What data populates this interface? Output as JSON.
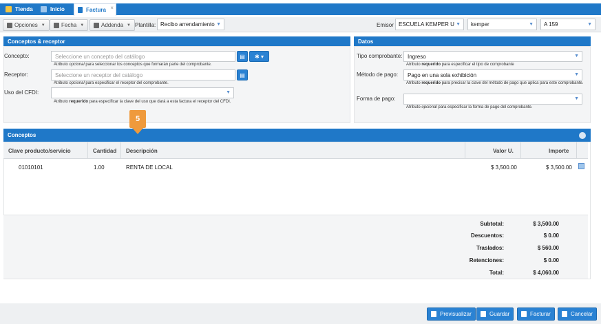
{
  "tabs": [
    {
      "label": "Tienda",
      "icon": "store-icon"
    },
    {
      "label": "Inicio",
      "icon": "home-icon"
    },
    {
      "label": "Factura",
      "icon": "document-icon",
      "close": "×"
    }
  ],
  "toolbar": {
    "opciones": "Opciones",
    "fecha": "Fecha",
    "addenda": "Addenda",
    "plantilla_label": "Plantilla:",
    "plantilla_value": "Recibo arrendamiento",
    "emisor_label": "Emisor",
    "emisor_value": "ESCUELA KEMPER U",
    "kemper_value": "kemper",
    "serie_value": "A 159"
  },
  "conceptos_receptor": {
    "title": "Conceptos & receptor",
    "concepto_label": "Concepto:",
    "concepto_placeholder": "Seleccione un concepto del catálogo",
    "concepto_hint_pre": "Atributo ",
    "concepto_hint_em": "opcional",
    "concepto_hint_post": " para seleccionar los conceptos que formarán parte del comprobante.",
    "receptor_label": "Receptor:",
    "receptor_placeholder": "Seleccione un receptor del catálogo",
    "receptor_hint_pre": "Atributo ",
    "receptor_hint_em": "opcional",
    "receptor_hint_post": " para especificar el receptor del comprobante.",
    "uso_label": "Uso del CFDI:",
    "uso_hint_pre": "Atributo ",
    "uso_hint_em": "requerido",
    "uso_hint_post": " para especificar la clave del uso que dará a esta factura el receptor del CFDI."
  },
  "datos": {
    "title": "Datos",
    "tipo_label": "Tipo comprobante:",
    "tipo_value": "Ingreso",
    "tipo_hint_pre": "Atributo ",
    "tipo_hint_em": "requerido",
    "tipo_hint_post": " para especificar el tipo de comprobante",
    "metodo_label": "Método de pago:",
    "metodo_value": "Pago en una sola exhibición",
    "metodo_hint_pre": "Atributo ",
    "metodo_hint_em": "requerido",
    "metodo_hint_post": " para precisar la clave del método de pago que aplica para este comprobante.",
    "forma_label": "Forma de pago:",
    "forma_hint_pre": "Atributo ",
    "forma_hint_em": "opcional",
    "forma_hint_post": " para especificar la forma de pago del comprobante."
  },
  "conceptos": {
    "title": "Conceptos",
    "columns": [
      "Clave producto/servicio",
      "Cantidad",
      "Descripción",
      "Valor U.",
      "Importe"
    ],
    "rows": [
      {
        "clave": "01010101",
        "cantidad": "1.00",
        "descripcion": "RENTA DE LOCAL",
        "valor": "$ 3,500.00",
        "importe": "$ 3,500.00"
      }
    ],
    "totals": [
      {
        "label": "Subtotal:",
        "value": "$ 3,500.00"
      },
      {
        "label": "Descuentos:",
        "value": "$ 0.00"
      },
      {
        "label": "Traslados:",
        "value": "$ 560.00"
      },
      {
        "label": "Retenciones:",
        "value": "$ 0.00"
      },
      {
        "label": "Total:",
        "value": "$ 4,060.00"
      }
    ]
  },
  "callout": "5",
  "footer": {
    "previsualizar": "Previsualizar",
    "guardar": "Guardar",
    "facturar": "Facturar",
    "cancelar": "Cancelar"
  },
  "colors": {
    "primary": "#1f78c8",
    "accent_callout": "#ef9a3c",
    "panel_bg": "#f4f5f6"
  }
}
